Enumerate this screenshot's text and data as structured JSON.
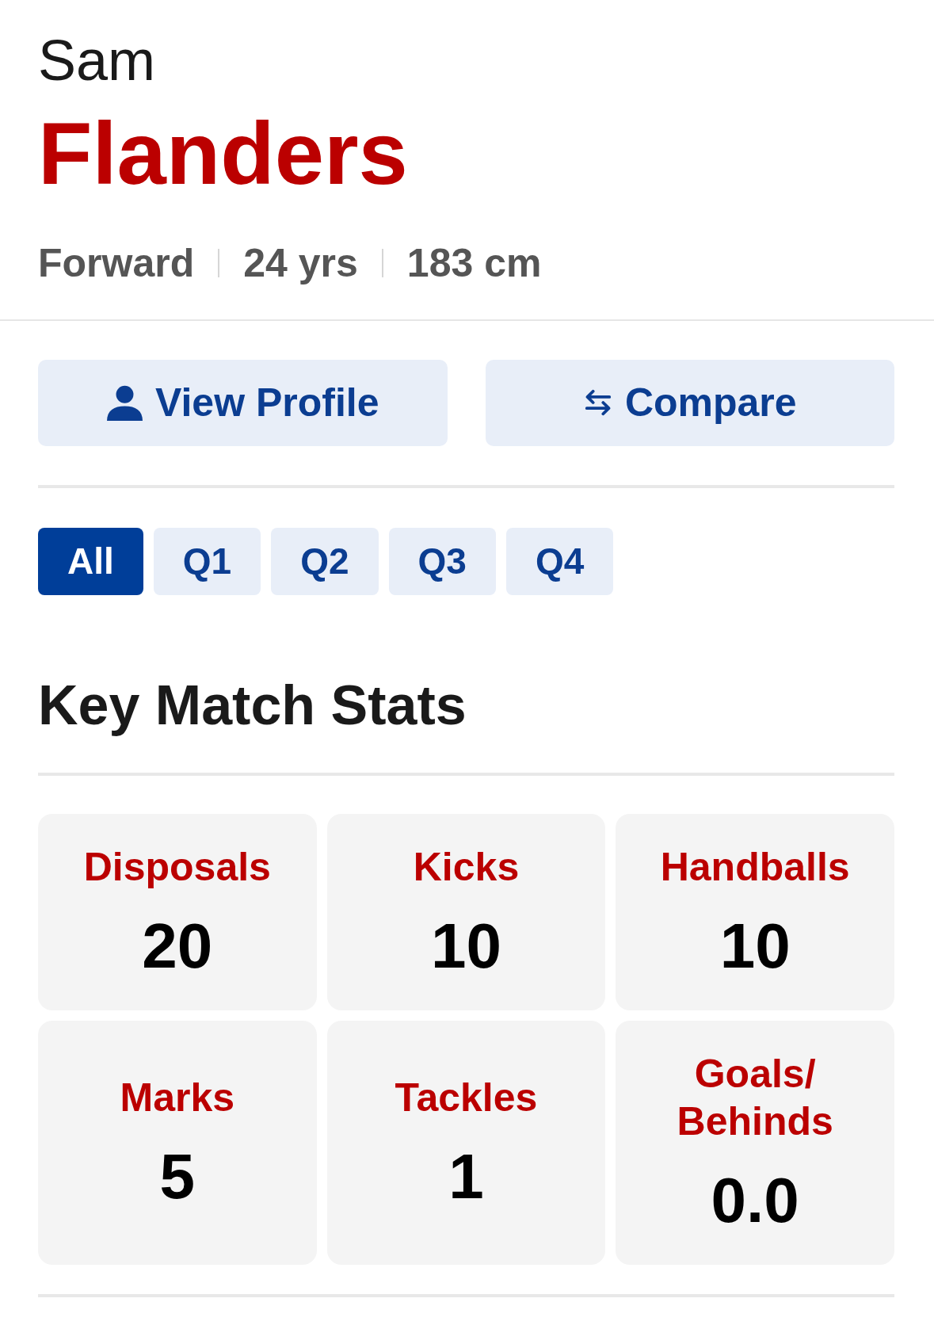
{
  "player": {
    "first_name": "Sam",
    "last_name": "Flanders",
    "details": [
      "Forward",
      "24 yrs",
      "183 cm"
    ]
  },
  "actions": [
    {
      "kind": "profile",
      "label": "View Profile"
    },
    {
      "kind": "compare",
      "label": "Compare"
    }
  ],
  "period_tabs": [
    {
      "label": "All",
      "selected": true
    },
    {
      "label": "Q1",
      "selected": false
    },
    {
      "label": "Q2",
      "selected": false
    },
    {
      "label": "Q3",
      "selected": false
    },
    {
      "label": "Q4",
      "selected": false
    }
  ],
  "stats_section": {
    "title": "Key Match Stats",
    "stats": [
      {
        "label": "Disposals",
        "value": "20"
      },
      {
        "label": "Kicks",
        "value": "10"
      },
      {
        "label": "Handballs",
        "value": "10"
      },
      {
        "label": "Marks",
        "value": "5"
      },
      {
        "label": "Tackles",
        "value": "1"
      },
      {
        "label": "Goals/Behinds",
        "value": "0.0"
      }
    ]
  }
}
